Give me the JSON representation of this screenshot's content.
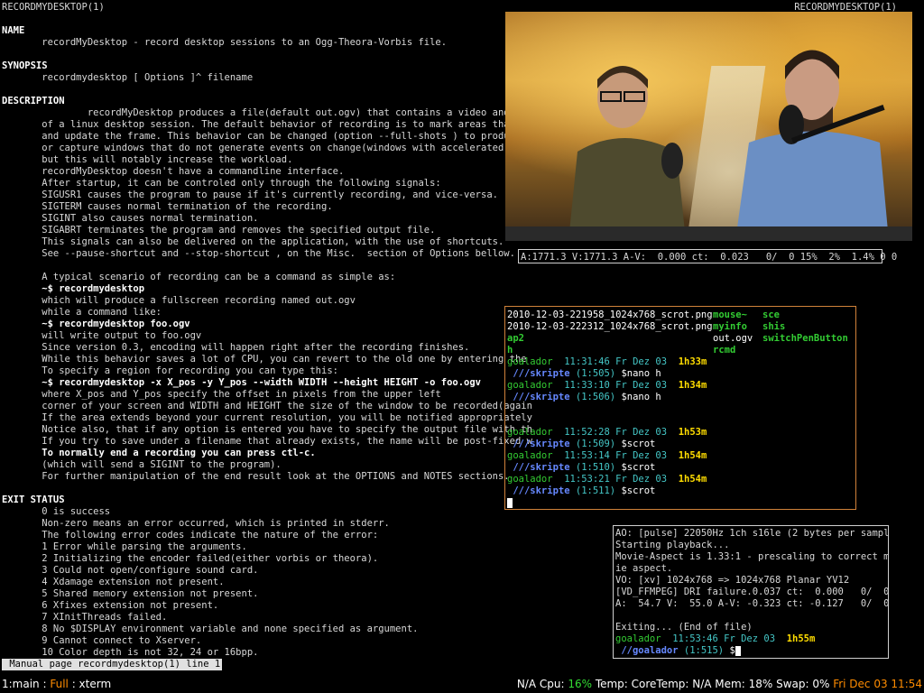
{
  "man": {
    "header_left": "RECORDMYDESKTOP(1)",
    "header_right": "RECORDMYDESKTOP(1)",
    "sections": {
      "name": "NAME",
      "synopsis": "SYNOPSIS",
      "description": "DESCRIPTION",
      "exit_status": "EXIT STATUS"
    },
    "lines": [
      "       recordMyDesktop - record desktop sessions to an Ogg-Theora-Vorbis file.",
      "       recordmydesktop [ Options ]^ filename",
      "               recordMyDesktop produces a file(default out.ogv) that contains a video and aud",
      "       of a linux desktop session. The default behavior of recording is to mark areas that hav",
      "       and update the frame. This behavior can be changed (option --full-shots ) to produce a",
      "       or capture windows that do not generate events on change(windows with accelerated 3d c",
      "       but this will notably increase the workload.",
      "       recordMyDesktop doesn't have a commandline interface.",
      "       After startup, it can be controled only through the following signals:",
      "       SIGUSR1 causes the program to pause if it's currently recording, and vice-versa.",
      "       SIGTERM causes normal termination of the recording.",
      "       SIGINT also causes normal termination.",
      "       SIGABRT terminates the program and removes the specified output file.",
      "       This signals can also be delivered on the application, with the use of shortcuts.",
      "       See --pause-shortcut and --stop-shortcut , on the Misc.  section of Options bellow.",
      "",
      "       A typical scenario of recording can be a command as simple as:",
      "       ~$ recordmydesktop",
      "       which will produce a fullscreen recording named out.ogv",
      "       while a command like:",
      "       ~$ recordmydesktop foo.ogv",
      "       will write output to foo.ogv",
      "       Since version 0.3, encoding will happen right after the recording finishes.",
      "       While this behavior saves a lot of CPU, you can revert to the old one by entering the",
      "       To specify a region for recording you can type this:",
      "       ~$ recordmydesktop -x X_pos -y Y_pos --width WIDTH --height HEIGHT -o foo.ogv",
      "       where X_pos and Y_pos specify the offset in pixels from the upper left",
      "       corner of your screen and WIDTH and HEIGHT the size of the window to be recorded(again",
      "       If the area extends beyond your current resolution, you will be notified appropriately",
      "       Notice also, that if any option is entered you have to specify the output file with th",
      "       If you try to save under a filename that already exists, the name will be post-fixed w",
      "       To normally end a recording you can press ctl-c.",
      "       (which will send a SIGINT to the program).",
      "       For further manipulation of the end result look at the OPTIONS and NOTES sections.",
      "",
      "       0 is success",
      "       Non-zero means an error occurred, which is printed in stderr.",
      "       The following error codes indicate the nature of the error:",
      "       1 Error while parsing the arguments.",
      "       2 Initializing the encoder failed(either vorbis or theora).",
      "       3 Could not open/configure sound card.",
      "       4 Xdamage extension not present.",
      "       5 Shared memory extension not present.",
      "       6 Xfixes extension not present.",
      "       7 XInitThreads failed.",
      "       8 No $DISPLAY environment variable and none specified as argument.",
      "       9 Cannot connect to Xserver.",
      "       10 Color depth is not 32, 24 or 16bpp."
    ],
    "status_line": " Manual page recordmydesktop(1) line 1"
  },
  "player": {
    "status": "A:1771.3 V:1771.3 A-V:  0.000 ct:  0.023   0/  0 15%  2%  1.4% 0 0"
  },
  "xterm1": {
    "files": [
      [
        "2010-12-03-221958_1024x768_scrot.png",
        "mouse~",
        "sce"
      ],
      [
        "2010-12-03-222312_1024x768_scrot.png",
        "myinfo",
        "shis"
      ],
      [
        "ap2",
        "out.ogv",
        "switchPenButton"
      ],
      [
        "h",
        "rcmd",
        ""
      ]
    ],
    "prompts": [
      {
        "user": "goalador",
        "time": "11:31:46",
        "date": "Fr Dez 03",
        "dur": "1h33m",
        "path": "///skripte",
        "hist": "(1:505)",
        "cmd": "$nano h"
      },
      {
        "user": "goalador",
        "time": "11:33:10",
        "date": "Fr Dez 03",
        "dur": "1h34m",
        "path": "///skripte",
        "hist": "(1:506)",
        "cmd": "$nano h"
      },
      {
        "user": "goalador",
        "time": "11:52:28",
        "date": "Fr Dez 03",
        "dur": "1h53m",
        "path": "///skripte",
        "hist": "(1:509)",
        "cmd": "$scrot"
      },
      {
        "user": "goalador",
        "time": "11:53:14",
        "date": "Fr Dez 03",
        "dur": "1h54m",
        "path": "///skripte",
        "hist": "(1:510)",
        "cmd": "$scrot"
      },
      {
        "user": "goalador",
        "time": "11:53:21",
        "date": "Fr Dez 03",
        "dur": "1h54m",
        "path": "///skripte",
        "hist": "(1:511)",
        "cmd": "$scrot"
      }
    ]
  },
  "xterm2": {
    "lines": [
      "AO: [pulse] 22050Hz 1ch s16le (2 bytes per sample)",
      "Starting playback...",
      "Movie-Aspect is 1.33:1 - prescaling to correct mov",
      "ie aspect.",
      "VO: [xv] 1024x768 => 1024x768 Planar YV12",
      "[VD_FFMPEG] DRI failure.0.037 ct:  0.000   0/  0",
      "A:  54.7 V:  55.0 A-V: -0.323 ct: -0.127   0/  0",
      "",
      "Exiting... (End of file)"
    ],
    "prompt": {
      "user": "goalador",
      "time": "11:53:46",
      "date": "Fr Dez 03",
      "dur": "1h55m",
      "path": "//goalador",
      "hist": "(1:515)",
      "cmd": "$"
    }
  },
  "panel": {
    "workspace": "1:main",
    "sep": " : ",
    "layout": "Full",
    "sep2": " : ",
    "window": "xterm",
    "stats_prefix": "N/A Cpu: ",
    "cpu": "16%",
    "stats_rest": " Temp: CoreTemp: N/A Mem: 18% Swap: 0% ",
    "datetime": "Fri Dec 03 11:54"
  },
  "colors": {
    "prompt_user": "#33cc33",
    "prompt_time": "#44c6c6",
    "prompt_dur": "#ffdd00",
    "prompt_path": "#6688ff",
    "panel_layout": "#ff8c00",
    "panel_cpu": "#33dd33"
  }
}
